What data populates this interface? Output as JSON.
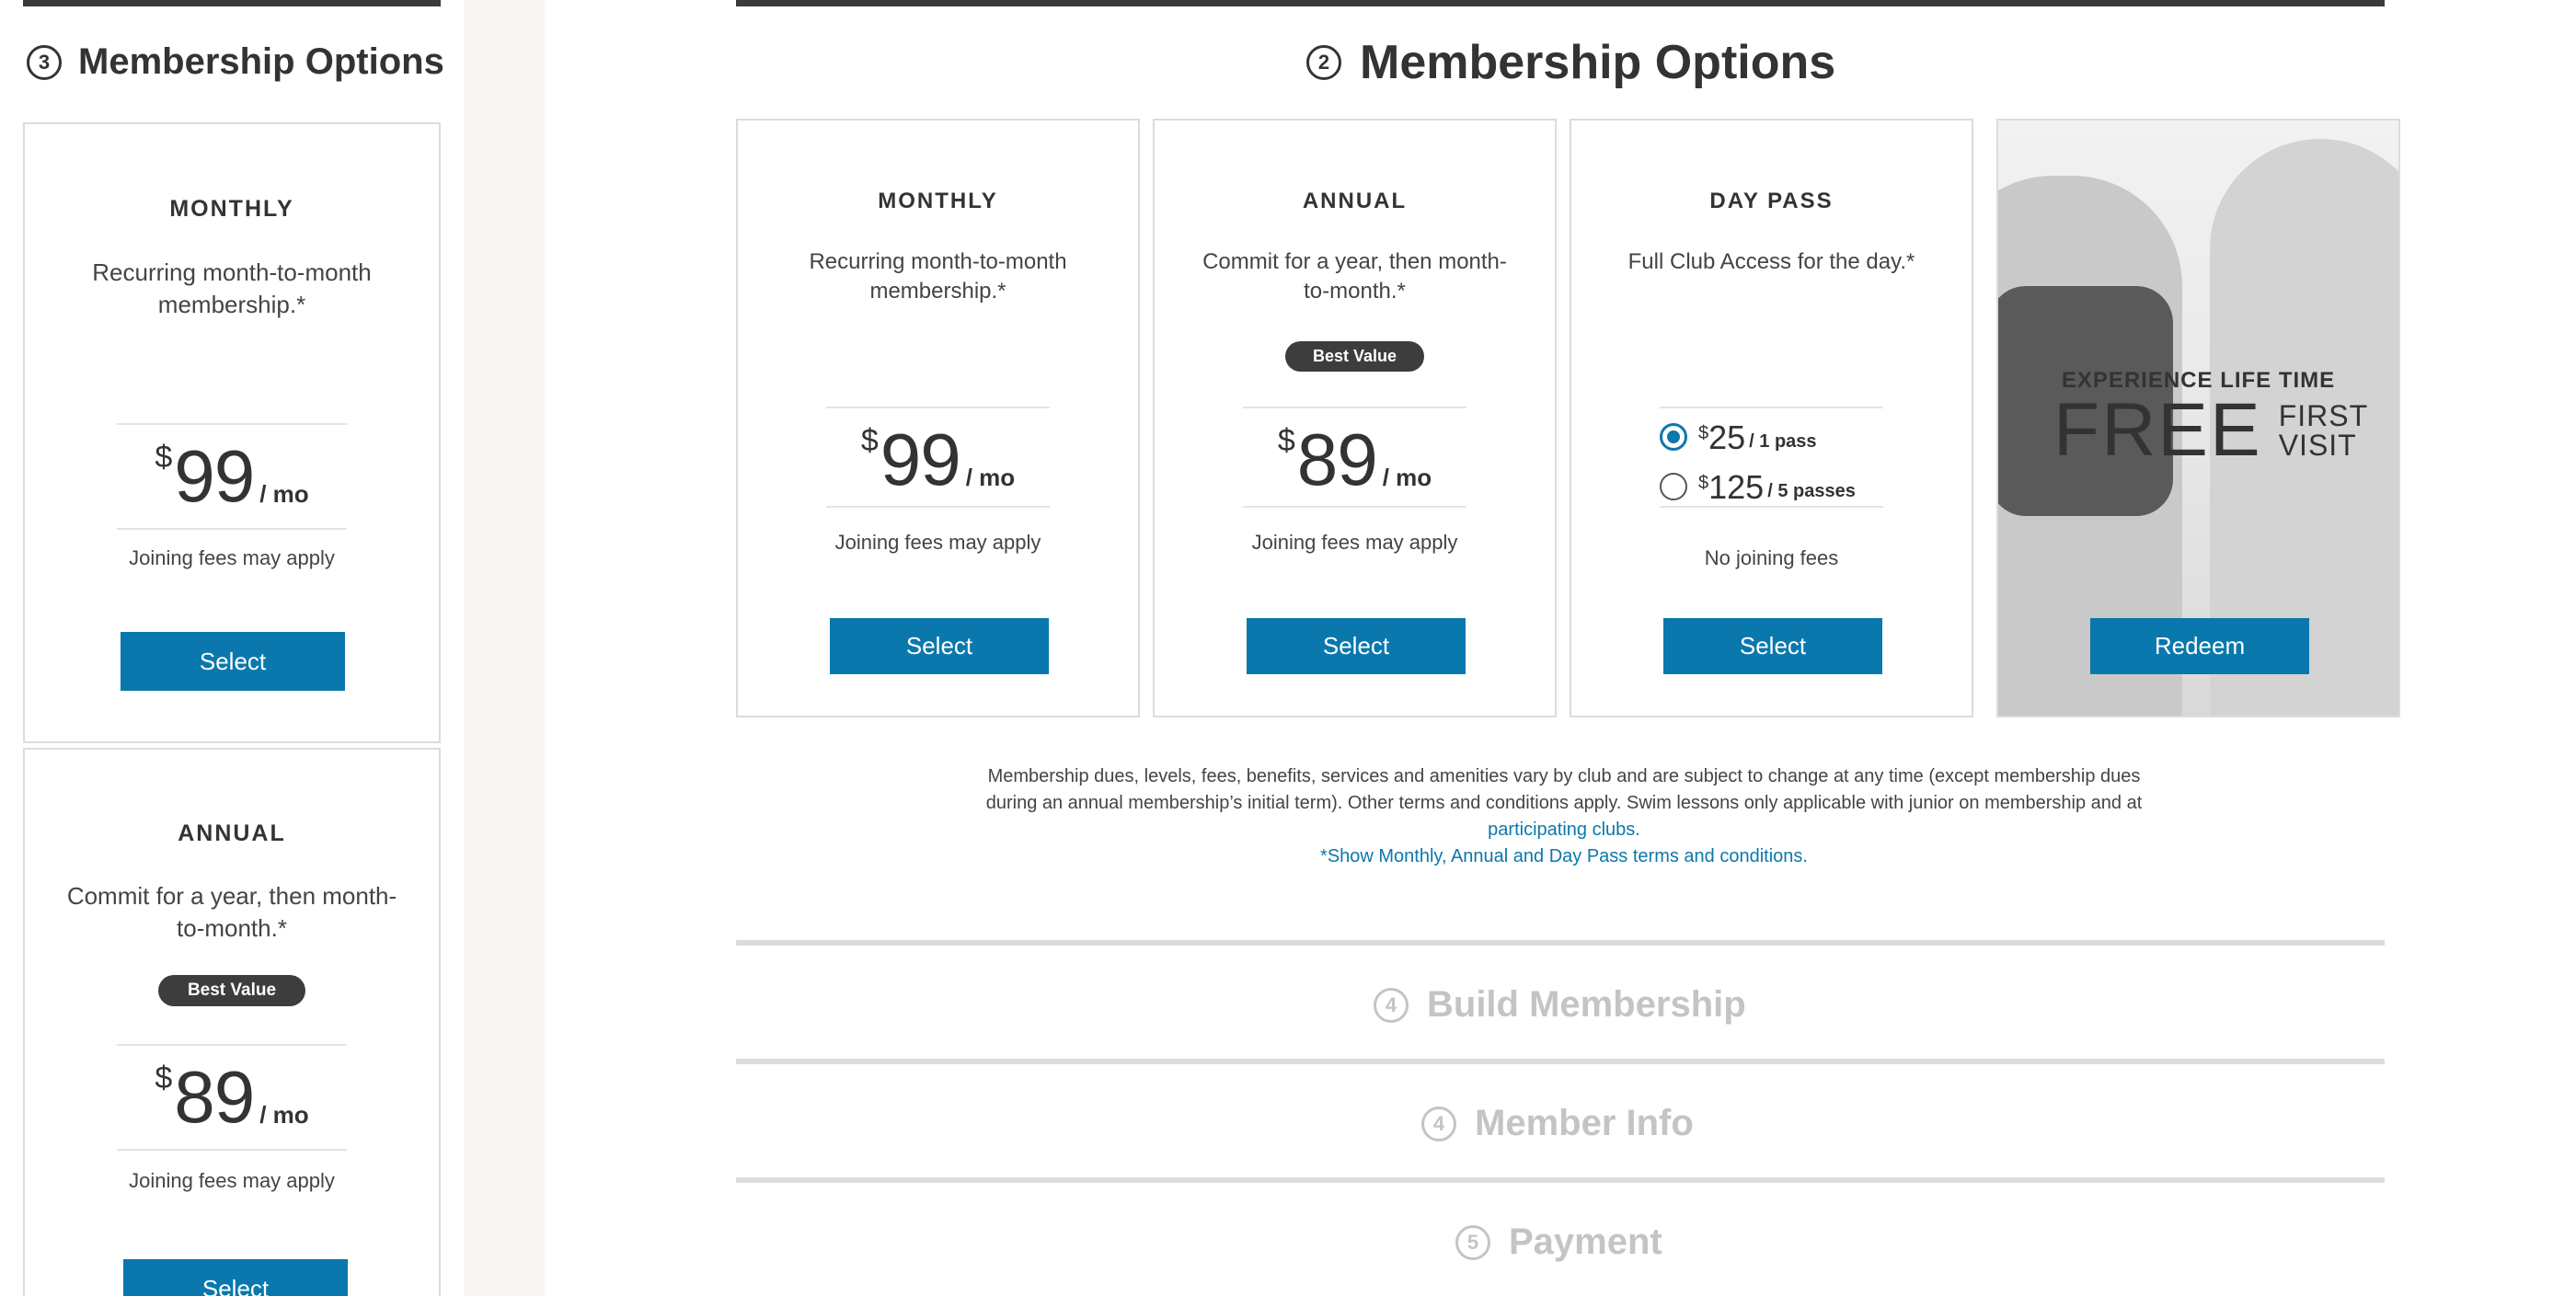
{
  "mobile": {
    "step_number": "3",
    "title": "Membership Options",
    "cards": [
      {
        "name": "MONTHLY",
        "description": "Recurring month-to-month membership.*",
        "badge": "",
        "currency": "$",
        "price": "99",
        "per": "/ mo",
        "fees": "Joining fees may apply",
        "button": "Select"
      },
      {
        "name": "ANNUAL",
        "description": "Commit for a year, then month-to-month.*",
        "badge": "Best Value",
        "currency": "$",
        "price": "89",
        "per": "/ mo",
        "fees": "Joining fees may apply",
        "button": "Select"
      }
    ]
  },
  "desktop": {
    "step_number": "2",
    "title": "Membership Options",
    "cards": [
      {
        "name": "MONTHLY",
        "description": "Recurring month-to-month membership.*",
        "currency": "$",
        "price": "99",
        "per": "/ mo",
        "fees": "Joining fees may apply",
        "button": "Select"
      },
      {
        "name": "ANNUAL",
        "description": "Commit for a year, then month-to-month.*",
        "badge": "Best Value",
        "currency": "$",
        "price": "89",
        "per": "/ mo",
        "fees": "Joining fees may apply",
        "button": "Select"
      },
      {
        "name": "DAY PASS",
        "description": "Full Club Access for the day.*",
        "options": [
          {
            "currency": "$",
            "price": "25",
            "per": "/ 1 pass",
            "selected": true
          },
          {
            "currency": "$",
            "price": "125",
            "per": "/ 5 passes",
            "selected": false
          }
        ],
        "fees": "No joining fees",
        "button": "Select"
      }
    ],
    "promo": {
      "line1": "EXPERIENCE LIFE TIME",
      "big": "FREE",
      "line2a": "FIRST",
      "line2b": "VISIT",
      "button": "Redeem"
    },
    "legal": {
      "text": "Membership dues, levels, fees, benefits, services and amenities vary by club and are subject to change at any time (except membership dues during an annual membership’s initial term). Other terms and conditions apply. Swim lessons only applicable with junior on membership and at",
      "link": "participating clubs.",
      "terms_link": "*Show Monthly, Annual and Day Pass terms and conditions."
    },
    "sections": [
      {
        "number": "4",
        "title": "Build Membership"
      },
      {
        "number": "4",
        "title": "Member Info"
      },
      {
        "number": "5",
        "title": "Payment"
      }
    ]
  },
  "colors": {
    "accent": "#0a78ad",
    "badge": "#3d3d3d",
    "muted": "#c4c4c4"
  }
}
